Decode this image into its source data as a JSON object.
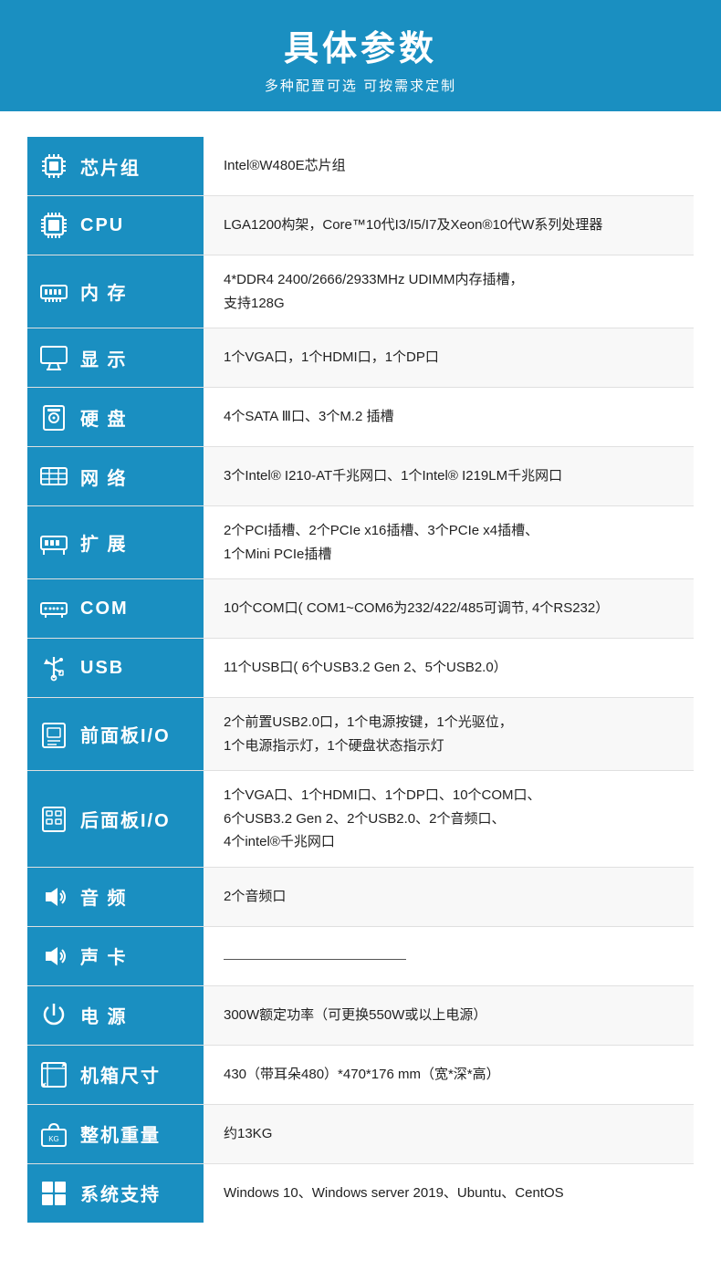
{
  "header": {
    "title": "具体参数",
    "subtitle": "多种配置可选 可按需求定制"
  },
  "rows": [
    {
      "id": "chipset",
      "label": "芯片组",
      "icon": "chipset",
      "value": "Intel®W480E芯片组"
    },
    {
      "id": "cpu",
      "label": "CPU",
      "icon": "cpu",
      "value": "LGA1200构架，Core™10代I3/I5/I7及Xeon®10代W系列处理器"
    },
    {
      "id": "memory",
      "label": "内 存",
      "icon": "memory",
      "value": "4*DDR4 2400/2666/2933MHz  UDIMM内存插槽，\n支持128G"
    },
    {
      "id": "display",
      "label": "显 示",
      "icon": "display",
      "value": "1个VGA口，1个HDMI口，1个DP口"
    },
    {
      "id": "hdd",
      "label": "硬 盘",
      "icon": "hdd",
      "value": " 4个SATA Ⅲ口、3个M.2 插槽"
    },
    {
      "id": "network",
      "label": "网 络",
      "icon": "network",
      "value": "3个Intel® I210-AT千兆网口、1个Intel® I219LM千兆网口"
    },
    {
      "id": "expansion",
      "label": "扩 展",
      "icon": "expansion",
      "value": "2个PCI插槽、2个PCIe x16插槽、3个PCIe x4插槽、\n1个Mini PCIe插槽"
    },
    {
      "id": "com",
      "label": "COM",
      "icon": "com",
      "value": "10个COM口( COM1~COM6为232/422/485可调节, 4个RS232）"
    },
    {
      "id": "usb",
      "label": "USB",
      "icon": "usb",
      "value": "11个USB口( 6个USB3.2 Gen 2、5个USB2.0）"
    },
    {
      "id": "front-io",
      "label": "前面板I/O",
      "icon": "front-io",
      "value": "2个前置USB2.0口，1个电源按键，1个光驱位，\n1个电源指示灯，1个硬盘状态指示灯"
    },
    {
      "id": "rear-io",
      "label": "后面板I/O",
      "icon": "rear-io",
      "value": "1个VGA口、1个HDMI口、1个DP口、10个COM口、\n6个USB3.2 Gen 2、2个USB2.0、2个音频口、\n4个intel®千兆网口"
    },
    {
      "id": "audio",
      "label": "音 频",
      "icon": "audio",
      "value": "2个音频口"
    },
    {
      "id": "soundcard",
      "label": "声 卡",
      "icon": "soundcard",
      "value": "__underline__"
    },
    {
      "id": "power",
      "label": "电 源",
      "icon": "power",
      "value": "300W额定功率（可更换550W或以上电源）"
    },
    {
      "id": "size",
      "label": "机箱尺寸",
      "icon": "size",
      "value": "430（带耳朵480）*470*176 mm（宽*深*高）"
    },
    {
      "id": "weight",
      "label": "整机重量",
      "icon": "weight",
      "value": "约13KG"
    },
    {
      "id": "os",
      "label": "系统支持",
      "icon": "os",
      "value": "Windows 10、Windows server 2019、Ubuntu、CentOS"
    }
  ]
}
